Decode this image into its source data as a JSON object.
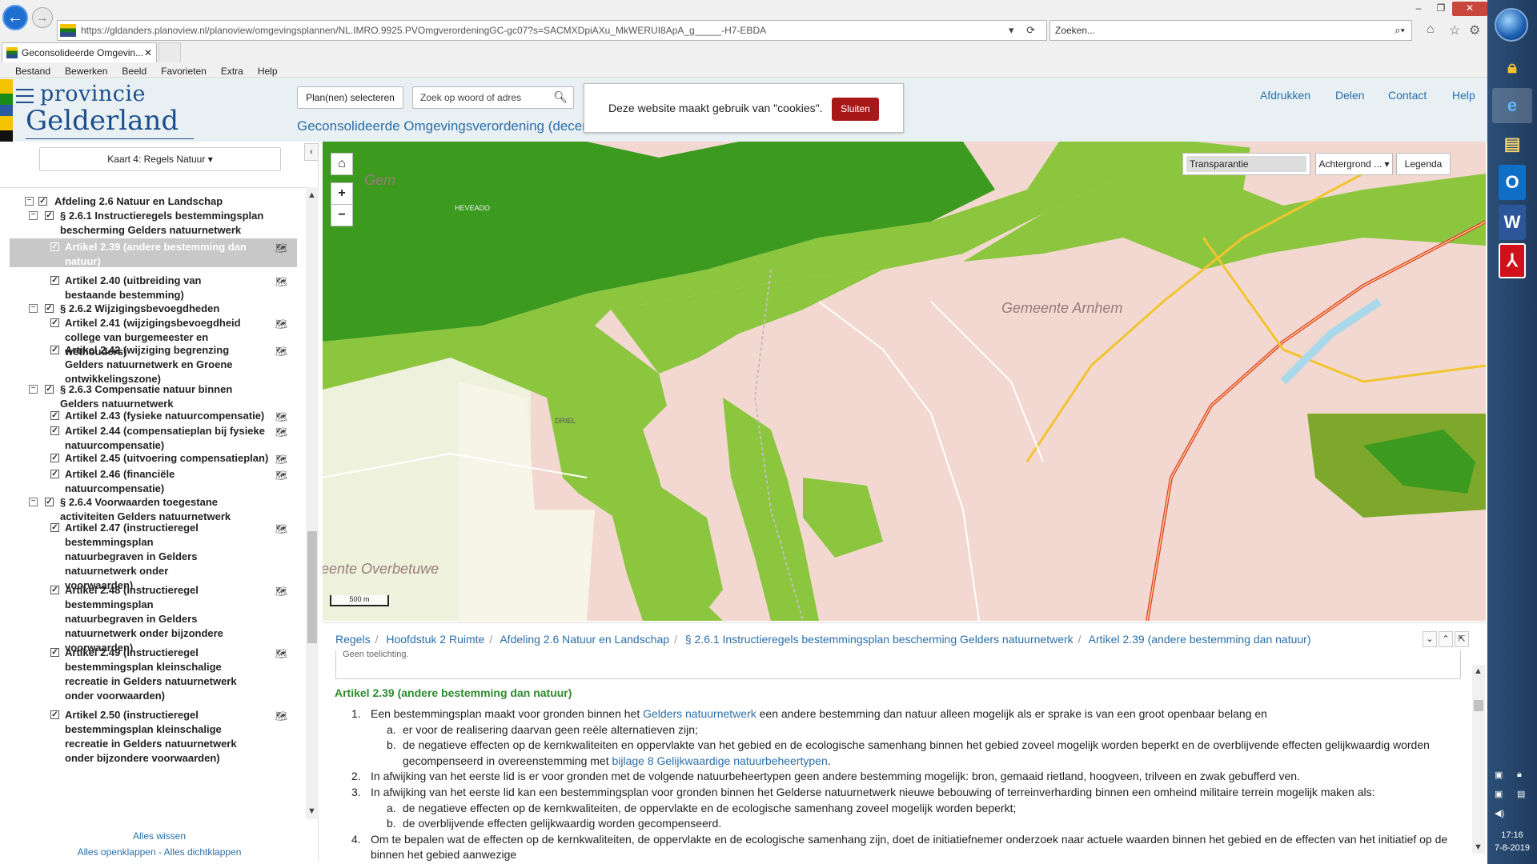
{
  "browser": {
    "url": "https://gldanders.planoview.nl/planoview/omgevingsplannen/NL.IMRO.9925.PVOmgverordeningGC-gc07?s=SACMXDpiAXu_MkWERUI8ApA_g_____-H7-EBDA",
    "search_placeholder": "Zoeken...",
    "tab_title": "Geconsolideerde Omgevin...",
    "menu": [
      "Bestand",
      "Bewerken",
      "Beeld",
      "Favorieten",
      "Extra",
      "Help"
    ]
  },
  "header": {
    "logo_line1": "provincie",
    "logo_line2": "Gelderland",
    "plan_button": "Plan(nen) selecteren",
    "search_placeholder": "Zoek op woord of adres",
    "title": "Geconsolideerde Omgevingsverordening (decemb",
    "links": [
      "Afdrukken",
      "Delen",
      "Contact",
      "Help"
    ],
    "colors": {
      "header_bg": "#e8f0f4",
      "link": "#2a6ea8"
    }
  },
  "cookie": {
    "message": "Deze website maakt gebruik van \"cookies\".",
    "button": "Sluiten"
  },
  "sidebar": {
    "kaart_select": "Kaart 4: Regels Natuur",
    "tree": [
      {
        "label": "Afdeling 2.6 Natuur en Landschap",
        "level": 0
      },
      {
        "label": "§ 2.6.1 Instructieregels bestemmingsplan bescherming Gelders natuurnetwerk",
        "level": 1
      },
      {
        "label": "Artikel 2.39 (andere bestemming dan natuur)",
        "level": 2,
        "selected": true
      },
      {
        "label": "Artikel 2.40 (uitbreiding van bestaande bestemming)",
        "level": 2
      },
      {
        "label": "§ 2.6.2 Wijzigingsbevoegdheden",
        "level": 1
      },
      {
        "label": "Artikel 2.41 (wijzigingsbevoegdheid college van burgemeester en wethouders)",
        "level": 2
      },
      {
        "label": "Artikel 2.42 (wijziging begrenzing Gelders natuurnetwerk en Groene ontwikkelingszone)",
        "level": 2
      },
      {
        "label": "§ 2.6.3 Compensatie natuur binnen Gelders natuurnetwerk",
        "level": 1
      },
      {
        "label": "Artikel 2.43 (fysieke natuurcompensatie)",
        "level": 2
      },
      {
        "label": "Artikel 2.44 (compensatieplan bij fysieke natuurcompensatie)",
        "level": 2
      },
      {
        "label": "Artikel 2.45 (uitvoering compensatieplan)",
        "level": 2
      },
      {
        "label": "Artikel 2.46 (financiële natuurcompensatie)",
        "level": 2
      },
      {
        "label": "§ 2.6.4 Voorwaarden toegestane activiteiten Gelders natuurnetwerk",
        "level": 1
      },
      {
        "label": "Artikel 2.47 (instructieregel bestemmingsplan natuurbegraven in Gelders natuurnetwerk onder voorwaarden)",
        "level": 2
      },
      {
        "label": "Artikel 2.48 (instructieregel bestemmingsplan natuurbegraven in Gelders natuurnetwerk onder bijzondere voorwaarden)",
        "level": 2
      },
      {
        "label": "Artikel 2.49 (instructieregel bestemmingsplan kleinschalige recreatie in Gelders natuurnetwerk onder voorwaarden)",
        "level": 2
      },
      {
        "label": "Artikel 2.50 (instructieregel bestemmingsplan kleinschalige recreatie in Gelders natuurnetwerk onder bijzondere voorwaarden)",
        "level": 2
      }
    ],
    "footer_collapse": "Alles wissen",
    "footer_expand": "Alles openklappen",
    "footer_sep": " - ",
    "footer_close": "Alles dichtklappen"
  },
  "map": {
    "transparency_label": "Transparantie",
    "background_button": "Achtergrond ...",
    "legend_button": "Legenda",
    "scale_label": "500 m",
    "labels": {
      "gem1": "Gem",
      "gem2": "Gemeente  Arnhem",
      "gem3": "eente  Overbetuwe",
      "driel": "DRIEL",
      "heveado": "HEVEADO"
    },
    "colors": {
      "natuur_dark": "#3c9a1e",
      "natuur_light": "#8cc63e",
      "built": "#f2d8d0",
      "agri": "#eef2dc"
    }
  },
  "content": {
    "breadcrumbs": [
      "Regels",
      "Hoofdstuk 2 Ruimte",
      "Afdeling 2.6 Natuur en Landschap",
      "§ 2.6.1 Instructieregels bestemmingsplan bescherming Gelders natuurnetwerk",
      "Artikel 2.39 (andere bestemming dan natuur)"
    ],
    "toelichting": "Geen toelichting.",
    "article_title": "Artikel 2.39 (andere bestemming dan natuur)",
    "p1_pre": "Een bestemmingsplan maakt voor gronden binnen het ",
    "p1_link": "Gelders natuurnetwerk",
    "p1_post": " een andere bestemming dan natuur alleen mogelijk als er sprake is van een groot openbaar belang en",
    "p1a": "er voor de realisering daarvan geen reële alternatieven zijn;",
    "p1b_pre": "de negatieve effecten op de kernkwaliteiten en oppervlakte van het gebied en de ecologische samenhang binnen het gebied zoveel mogelijk worden beperkt en de overblijvende effecten gelijkwaardig worden gecompenseerd in overeenstemming met ",
    "p1b_link": "bijlage 8 Gelijkwaardige natuurbeheertypen",
    "p1b_post": ".",
    "p2": "In afwijking van het eerste lid is er voor gronden met de volgende natuurbeheertypen geen andere bestemming mogelijk: bron, gemaaid rietland, hoogveen, trilveen en zwak gebufferd ven.",
    "p3": "In afwijking van het eerste lid kan een bestemmingsplan voor gronden binnen het Gelderse natuurnetwerk nieuwe bebouwing of terreinverharding binnen een omheind militaire terrein mogelijk maken als:",
    "p3a": "de negatieve effecten op de kernkwaliteiten, de oppervlakte en de ecologische samenhang zoveel mogelijk worden beperkt;",
    "p3b": "de overblijvende effecten gelijkwaardig worden gecompenseerd.",
    "p4": "Om te bepalen wat de effecten op de kernkwaliteiten, de oppervlakte en de ecologische samenhang zijn, doet de initiatiefnemer onderzoek naar actuele waarden binnen het gebied en de effecten van het initiatief op de binnen het gebied aanwezige",
    "colors": {
      "title": "#2e8b2e",
      "link": "#2a6ea8"
    }
  },
  "taskbar": {
    "time": "17:16",
    "date": "7-8-2019"
  }
}
